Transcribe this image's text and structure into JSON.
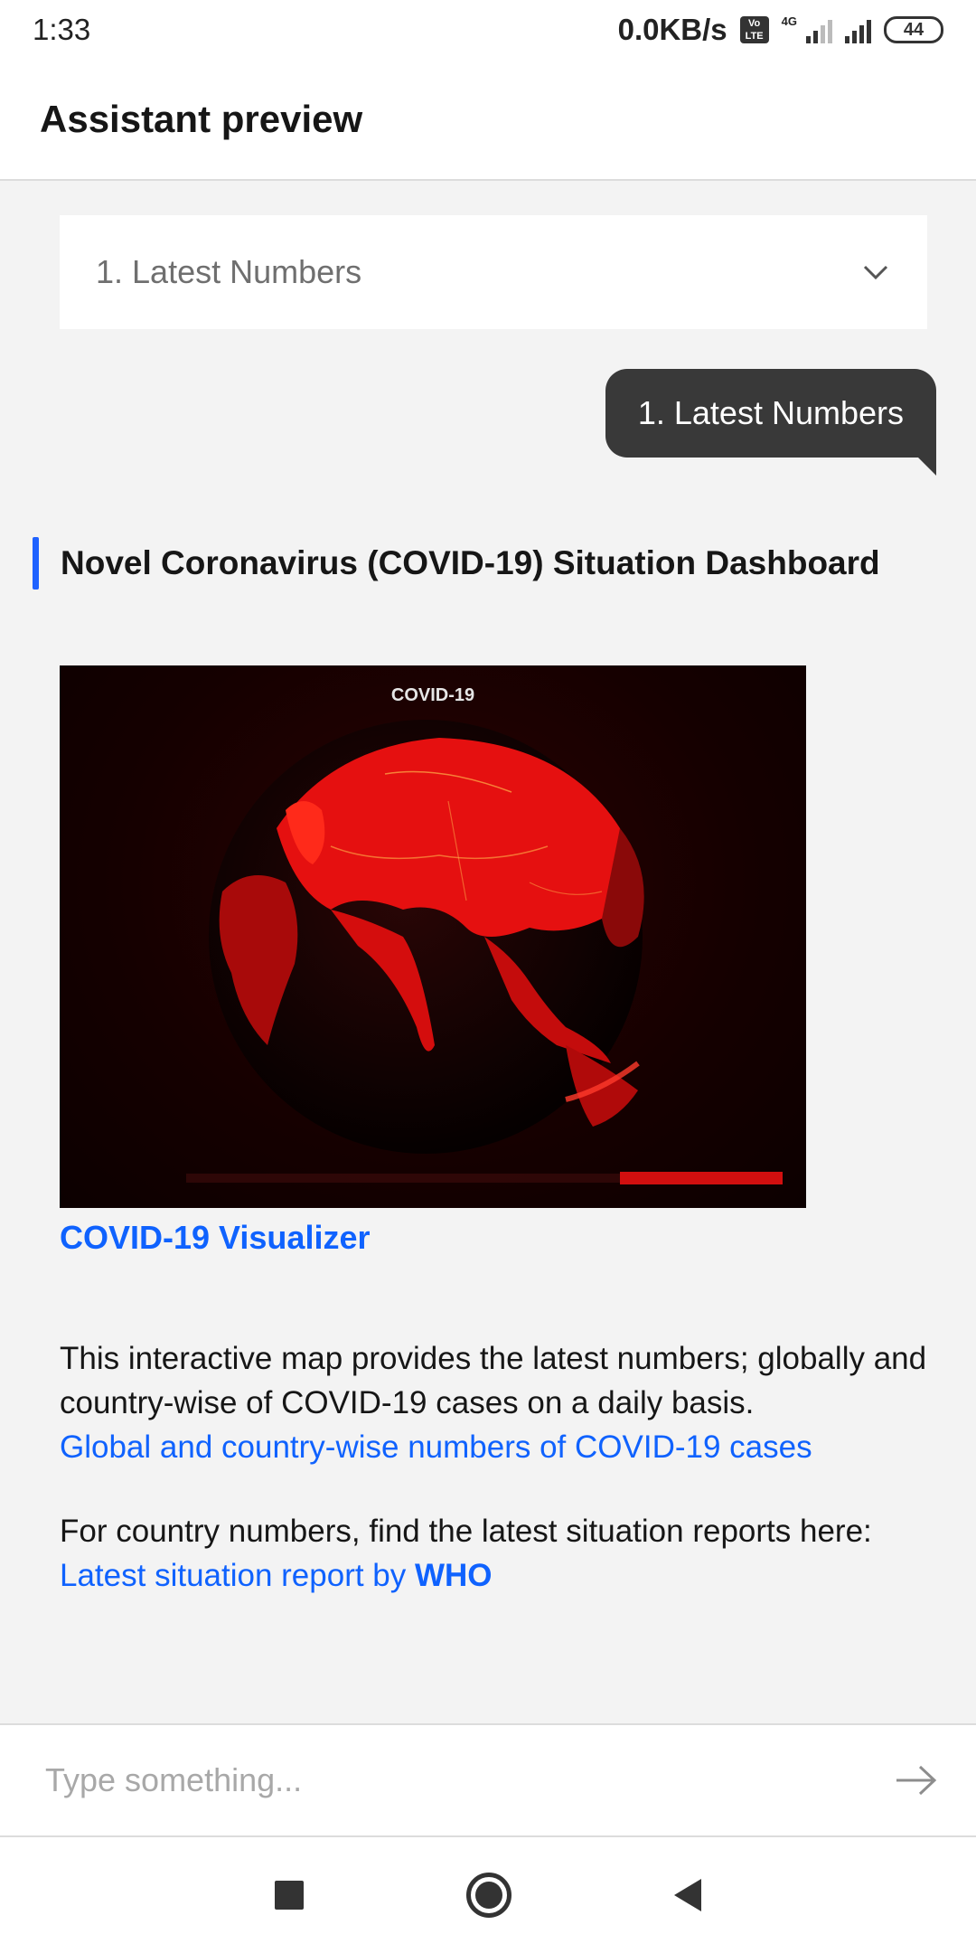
{
  "status_bar": {
    "time": "1:33",
    "net_speed": "0.0KB/s",
    "volte_label": "Vo LTE",
    "network_type": "4G",
    "battery": "44"
  },
  "header": {
    "title": "Assistant preview"
  },
  "dropdown": {
    "selected": "1. Latest Numbers",
    "icon": "chevron-down-icon"
  },
  "user_message": {
    "text": "1. Latest Numbers"
  },
  "card": {
    "title": "Novel Coronavirus (COVID-19) Situation Dashboard",
    "image_title": "COVID-19",
    "link_title": "COVID-19 Visualizer",
    "paragraph1": "This interactive map provides the latest numbers; globally and country-wise of COVID-19 cases on a daily basis.",
    "link1": "Global and country-wise numbers of COVID-19 cases",
    "paragraph2": "For country numbers, find the latest situation reports here:",
    "link2_prefix": "Latest situation report by ",
    "link2_bold": "WHO"
  },
  "input": {
    "placeholder": "Type something...",
    "value": ""
  },
  "colors": {
    "accent": "#0f62fe",
    "bubble": "#393939",
    "background": "#f3f3f3"
  }
}
